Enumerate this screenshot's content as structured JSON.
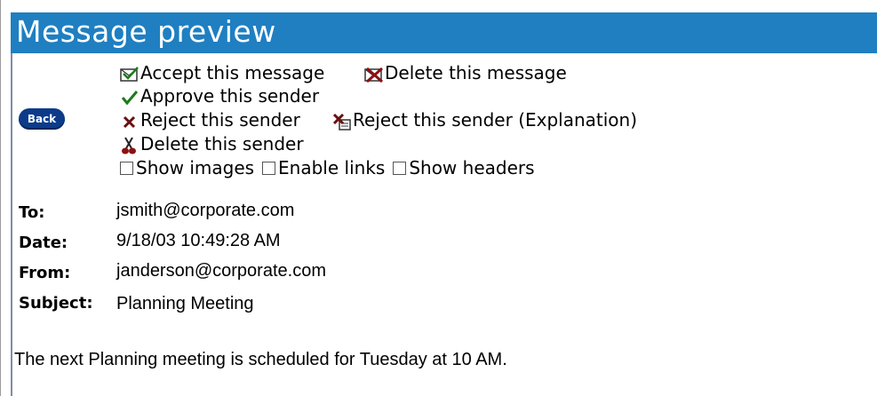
{
  "window": {
    "title": "Message preview"
  },
  "back_button": {
    "label": "Back"
  },
  "actions": {
    "accept": "Accept this message",
    "delete_message": "Delete this message",
    "approve_sender": "Approve this sender",
    "reject_sender": "Reject this sender",
    "reject_sender_explanation": "Reject this sender (Explanation)",
    "delete_sender": "Delete this sender"
  },
  "options": {
    "show_images": "Show images",
    "enable_links": "Enable links",
    "show_headers": "Show headers"
  },
  "headers": {
    "to_label": "To:",
    "to_value": "jsmith@corporate.com",
    "date_label": "Date:",
    "date_value": "9/18/03 10:49:28 AM",
    "from_label": "From:",
    "from_value": "janderson@corporate.com",
    "subject_label": "Subject:",
    "subject_value": "Planning Meeting"
  },
  "message": {
    "body": "The next Planning meeting is scheduled for Tuesday at 10 AM."
  },
  "colors": {
    "titlebar": "#1f7fc1",
    "back_button": "#0c3b8a",
    "approve_check": "#1a7a1a"
  },
  "icons": {
    "accept": "envelope-check-icon",
    "delete_message": "envelope-x-icon",
    "approve": "checkmark-icon",
    "reject": "x-mark-icon",
    "reject_explanation": "envelope-x-note-icon",
    "delete_sender": "scissors-icon"
  }
}
